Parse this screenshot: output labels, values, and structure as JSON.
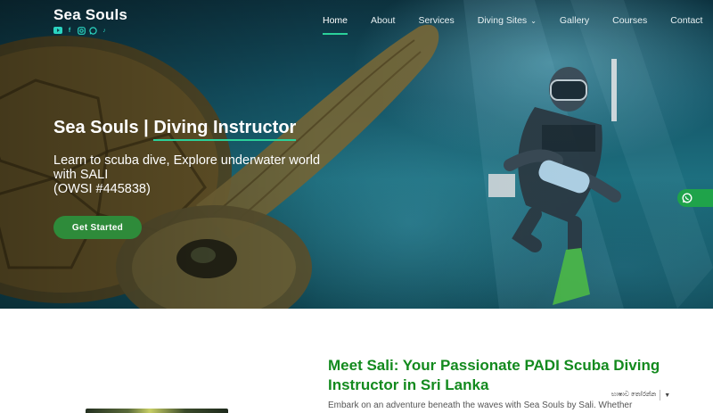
{
  "brand": {
    "name": "Sea Souls",
    "social_icons": [
      "youtube-icon",
      "facebook-icon",
      "instagram-icon",
      "whatsapp-icon",
      "tiktok-icon"
    ]
  },
  "nav": {
    "items": [
      {
        "label": "Home",
        "active": true
      },
      {
        "label": "About"
      },
      {
        "label": "Services"
      },
      {
        "label": "Diving Sites",
        "dropdown": true
      },
      {
        "label": "Gallery"
      },
      {
        "label": "Courses"
      },
      {
        "label": "Contact"
      }
    ]
  },
  "hero": {
    "title_prefix": "Sea Souls | ",
    "title_highlight": "Diving Instructor",
    "subtitle_line1": "Learn to scuba dive, Explore underwater world",
    "subtitle_line2": "with SALI",
    "subtitle_line3": "(OWSI #445838)",
    "cta_label": "Get Started"
  },
  "content": {
    "heading": "Meet Sali: Your Passionate PADI Scuba Diving Instructor in Sri Lanka",
    "body": "Embark on an adventure beneath the waves with Sea Souls by Sali. Whether"
  },
  "language_selector": {
    "label": "භාෂාව තෝරන්න"
  },
  "colors": {
    "accent_green": "#2e8b3a",
    "underline_green": "#2bd19a",
    "heading_green": "#138a1e",
    "whatsapp_green": "#1fa34a"
  }
}
